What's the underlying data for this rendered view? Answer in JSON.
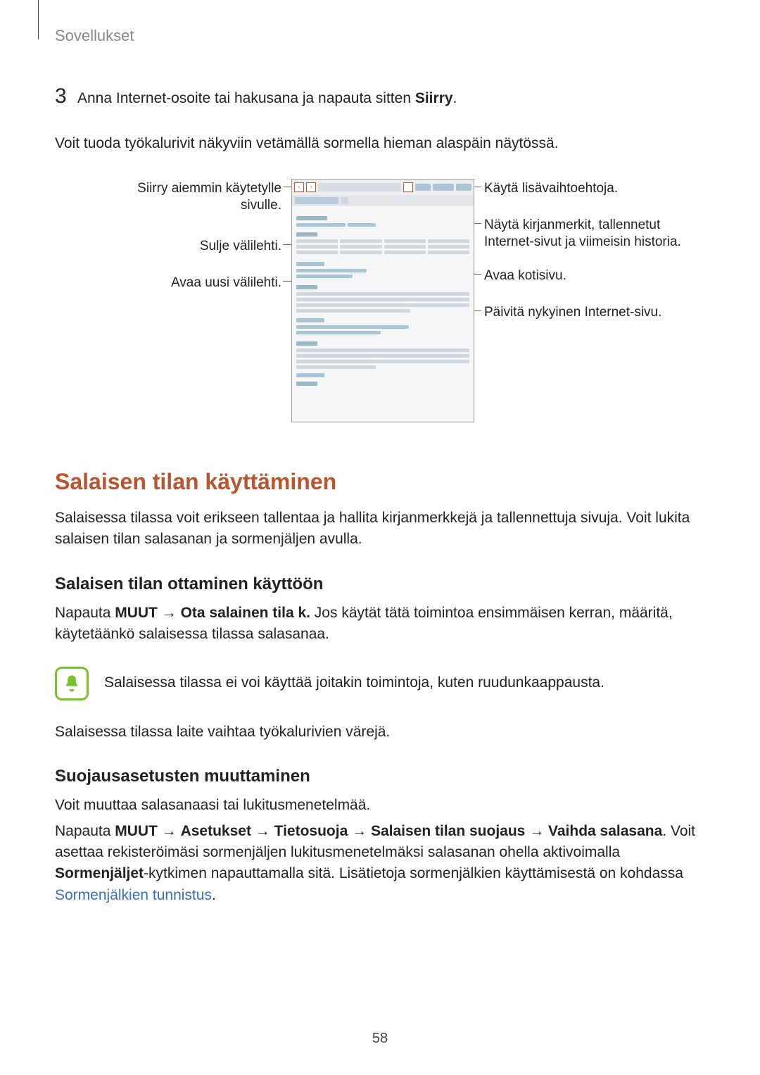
{
  "header": {
    "app_section": "Sovellukset"
  },
  "step": {
    "number": "3",
    "text_before": "Anna Internet-osoite tai hakusana ja napauta sitten ",
    "text_bold": "Siirry",
    "text_after": "."
  },
  "intro_para": "Voit tuoda työkalurivit näkyviin vetämällä sormella hieman alaspäin näytössä.",
  "callouts": {
    "l1": "Siirry aiemmin käytetylle sivulle.",
    "l2": "Sulje välilehti.",
    "l3": "Avaa uusi välilehti.",
    "r1": "Käytä lisävaihtoehtoja.",
    "r2": "Näytä kirjanmerkit, tallennetut Internet-sivut ja viimeisin historia.",
    "r3": "Avaa kotisivu.",
    "r4": "Päivitä nykyinen Internet-sivu."
  },
  "section1": {
    "title": "Salaisen tilan käyttäminen",
    "body": "Salaisessa tilassa voit erikseen tallentaa ja hallita kirjanmerkkejä ja tallennettuja sivuja. Voit lukita salaisen tilan salasanan ja sormenjäljen avulla."
  },
  "section2": {
    "title": "Salaisen tilan ottaminen käyttöön",
    "p1_a": "Napauta ",
    "p1_bold1": "MUUT",
    "p1_arrow": " → ",
    "p1_bold2": "Ota salainen tila k.",
    "p1_b": " Jos käytät tätä toimintoa ensimmäisen kerran, määritä, käytetäänkö salaisessa tilassa salasanaa.",
    "note": "Salaisessa tilassa ei voi käyttää joitakin toimintoja, kuten ruudunkaappausta.",
    "p2": "Salaisessa tilassa laite vaihtaa työkalurivien värejä."
  },
  "section3": {
    "title": "Suojausasetusten muuttaminen",
    "p1": "Voit muuttaa salasanaasi tai lukitusmenetelmää.",
    "p2_a": "Napauta ",
    "p2_b1": "MUUT",
    "p2_arr": " → ",
    "p2_b2": "Asetukset",
    "p2_b3": "Tietosuoja",
    "p2_b4": "Salaisen tilan suojaus",
    "p2_b5": "Vaihda salasana",
    "p2_tail1": ". Voit asettaa rekisteröimäsi sormenjäljen lukitusmenetelmäksi salasanan ohella aktivoimalla ",
    "p2_b6": "Sormenjäljet",
    "p2_tail2": "-kytkimen napauttamalla sitä. Lisätietoja sormenjälkien käyttämisestä on kohdassa ",
    "p2_link": "Sormenjälkien tunnistus",
    "p2_tail3": "."
  },
  "pagenum": "58"
}
